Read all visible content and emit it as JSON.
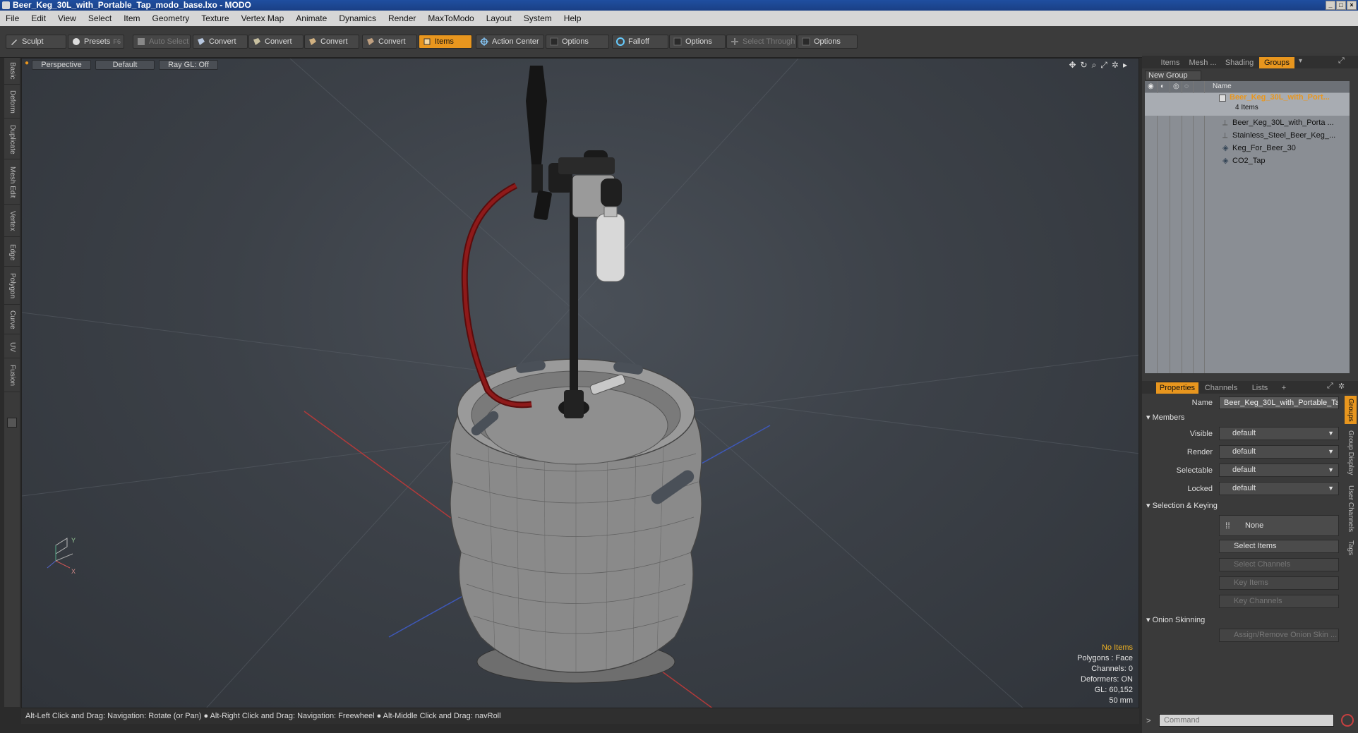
{
  "window": {
    "title": "Beer_Keg_30L_with_Portable_Tap_modo_base.lxo - MODO"
  },
  "menu": [
    "File",
    "Edit",
    "View",
    "Select",
    "Item",
    "Geometry",
    "Texture",
    "Vertex Map",
    "Animate",
    "Dynamics",
    "Render",
    "MaxToModo",
    "Layout",
    "System",
    "Help"
  ],
  "toolbar": {
    "sculpt": "Sculpt",
    "presets": "Presets",
    "presets_key": "F6",
    "auto_select": "Auto Select",
    "convert1": "Convert",
    "convert2": "Convert",
    "convert3": "Convert",
    "convert4": "Convert",
    "items": "Items",
    "action_center": "Action Center",
    "options1": "Options",
    "falloff": "Falloff",
    "options2": "Options",
    "select_through": "Select Through",
    "options3": "Options"
  },
  "left_tabs": [
    "Basic",
    "Deform",
    "Duplicate",
    "Mesh Edit",
    "Vertex",
    "Edge",
    "Polygon",
    "Curve",
    "UV",
    "Fusion"
  ],
  "viewport": {
    "view": "Perspective",
    "shading": "Default",
    "raygl": "Ray GL: Off",
    "info": {
      "no_items": "No Items",
      "polygons": "Polygons : Face",
      "channels": "Channels: 0",
      "deformers": "Deformers: ON",
      "gl": "GL: 60,152",
      "scale": "50 mm"
    },
    "axes": {
      "x": "X",
      "y": "Y"
    }
  },
  "status": "Alt-Left Click and Drag: Navigation: Rotate (or Pan) ● Alt-Right Click and Drag: Navigation: Freewheel ● Alt-Middle Click and Drag: navRoll",
  "right_panel": {
    "top_tabs": [
      "Items",
      "Mesh ...",
      "Shading",
      "Groups"
    ],
    "new_group": "New Group",
    "name_col": "Name",
    "group": {
      "name": "Beer_Keg_30L_with_Port...",
      "count": "4 Items",
      "children": [
        "Beer_Keg_30L_with_Porta ...",
        "Stainless_Steel_Beer_Keg_...",
        "Keg_For_Beer_30",
        "CO2_Tap"
      ]
    },
    "bottom_tabs": [
      "Properties",
      "Channels",
      "Lists",
      "+"
    ],
    "props": {
      "name_label": "Name",
      "name_value": "Beer_Keg_30L_with_Portable_Ta",
      "members": "Members",
      "visible_label": "Visible",
      "visible_value": "default",
      "render_label": "Render",
      "render_value": "default",
      "selectable_label": "Selectable",
      "selectable_value": "default",
      "locked_label": "Locked",
      "locked_value": "default",
      "selection_keying": "Selection & Keying",
      "none": "None",
      "select_items": "Select Items",
      "select_channels": "Select Channels",
      "key_items": "Key Items",
      "key_channels": "Key Channels",
      "onion": "Onion Skinning",
      "onion_btn": "Assign/Remove Onion Skin ..."
    },
    "side_tabs": [
      "Groups",
      "Group Display",
      "User Channels",
      "Tags"
    ],
    "command_placeholder": "Command"
  }
}
